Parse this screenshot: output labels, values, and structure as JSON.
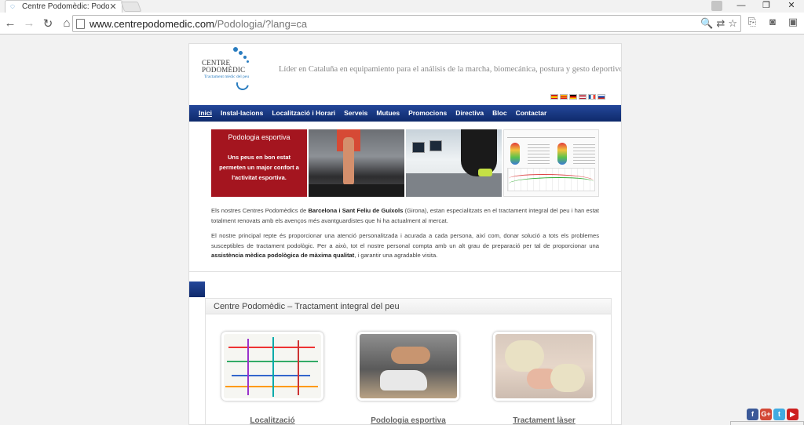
{
  "browser": {
    "tab_title": "Centre Podomèdic: Podolo",
    "tab_close": "✕",
    "url_host": "www.centrepodomedic.com",
    "url_path": "/Podologia/?lang=ca",
    "window": {
      "minimize": "—",
      "maximize": "❐",
      "close": "✕"
    }
  },
  "site": {
    "logo_line1": "CENTRE",
    "logo_line2": "PODOMÈDIC",
    "logo_tagline": "Tractament mèdic del peu",
    "tagline": "Líder en Cataluña en equipamiento para el análisis de la marcha, biomecánica, postura y gesto deportivo.",
    "flags": [
      "es",
      "ca",
      "de",
      "en",
      "fr",
      "ru"
    ],
    "nav": [
      {
        "label": "Inici",
        "active": true
      },
      {
        "label": "Instal·lacions"
      },
      {
        "label": "Localització i Horari"
      },
      {
        "label": "Serveis"
      },
      {
        "label": "Mutues"
      },
      {
        "label": "Promocions"
      },
      {
        "label": "Directiva"
      },
      {
        "label": "Bloc"
      },
      {
        "label": "Contactar"
      }
    ],
    "banner": {
      "title": "Podologia esportiva",
      "text": "Uns peus en bon estat permeten un major confort a l'activitat esportiva."
    },
    "intro_p1": {
      "pre": "Els nostres Centres Podomèdics de ",
      "bold": "Barcelona i Sant Feliu de Guíxols",
      "post": " (Girona), estan especialitzats en el tractament integral del peu i han estat totalment renovats amb els avenços més avantguardistes que hi ha actualment al mercat."
    },
    "intro_p2": {
      "pre": "El nostre principal repte és proporcionar una atenció personalitzada i acurada a cada persona, així com, donar solució a tots els problemes susceptibles de tractament podològic. Per a això, tot el nostre personal compta amb un alt grau de preparació per tal de proporcionar una ",
      "bold": "assistència mèdica podològica de màxima qualitat",
      "post": ", i garantir una agradable visita."
    },
    "section_title": "Centre Podomèdic – Tractament integral del peu",
    "cards": [
      {
        "label": "Localització"
      },
      {
        "label": "Podologia esportiva"
      },
      {
        "label": "Tractament làser"
      }
    ],
    "social": [
      {
        "name": "facebook",
        "glyph": "f",
        "color": "#3b5998"
      },
      {
        "name": "google-plus",
        "glyph": "G+",
        "color": "#d34836"
      },
      {
        "name": "twitter",
        "glyph": "t",
        "color": "#41abe1"
      },
      {
        "name": "youtube",
        "glyph": "▶",
        "color": "#cd201f"
      }
    ]
  }
}
